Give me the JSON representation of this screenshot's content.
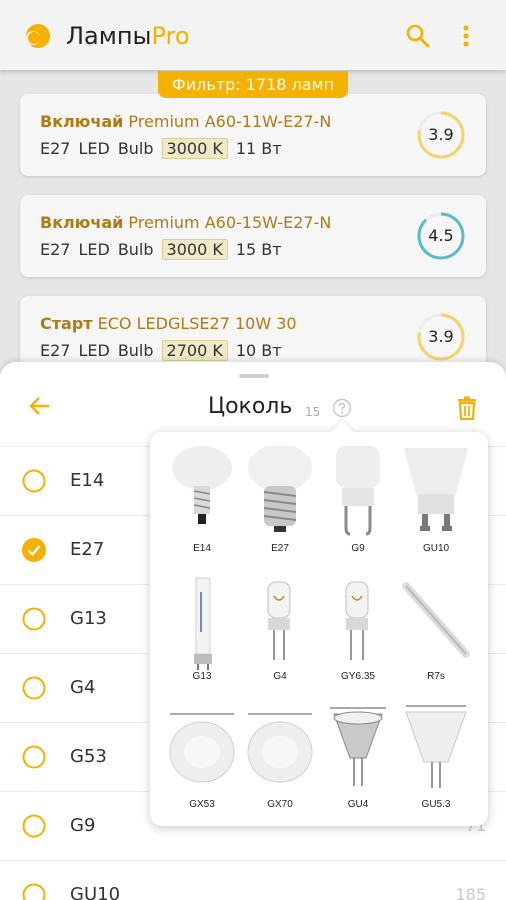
{
  "app": {
    "brand_main": "Лампы",
    "brand_accent": "Pro",
    "accent_color": "#f5b100"
  },
  "filter_pill": "Фильтр: 1718 ламп",
  "products": [
    {
      "brand": "Включай",
      "model": "Premium A60-11W-E27-N",
      "base": "E27",
      "type": "LED",
      "shape": "Bulb",
      "kelvin": "3000 K",
      "power": "11 Вт",
      "rating": "3.9",
      "rating_fraction": 0.78,
      "rating_color": "#f5d36b"
    },
    {
      "brand": "Включай",
      "model": "Premium A60-15W-E27-N",
      "base": "E27",
      "type": "LED",
      "shape": "Bulb",
      "kelvin": "3000 K",
      "power": "15 Вт",
      "rating": "4.5",
      "rating_fraction": 0.88,
      "rating_color": "#5bbcc9"
    },
    {
      "brand": "Старт",
      "model": "ECO LEDGLSE27 10W 30",
      "base": "E27",
      "type": "LED",
      "shape": "Bulb",
      "kelvin": "2700 K",
      "power": "10 Вт",
      "rating": "3.9",
      "rating_fraction": 0.78,
      "rating_color": "#f5d36b"
    }
  ],
  "sheet": {
    "title": "Цоколь",
    "count": "15",
    "options": [
      {
        "label": "E14",
        "checked": false,
        "count": ""
      },
      {
        "label": "E27",
        "checked": true,
        "count": ""
      },
      {
        "label": "G13",
        "checked": false,
        "count": ""
      },
      {
        "label": "G4",
        "checked": false,
        "count": ""
      },
      {
        "label": "G53",
        "checked": false,
        "count": ""
      },
      {
        "label": "G9",
        "checked": false,
        "count": "71"
      },
      {
        "label": "GU10",
        "checked": false,
        "count": "185"
      }
    ]
  },
  "popover": {
    "bases": [
      "E14",
      "E27",
      "G9",
      "GU10",
      "G13",
      "G4",
      "GY6.35",
      "R7s",
      "GX53",
      "GX70",
      "GU4",
      "GU5.3"
    ]
  }
}
